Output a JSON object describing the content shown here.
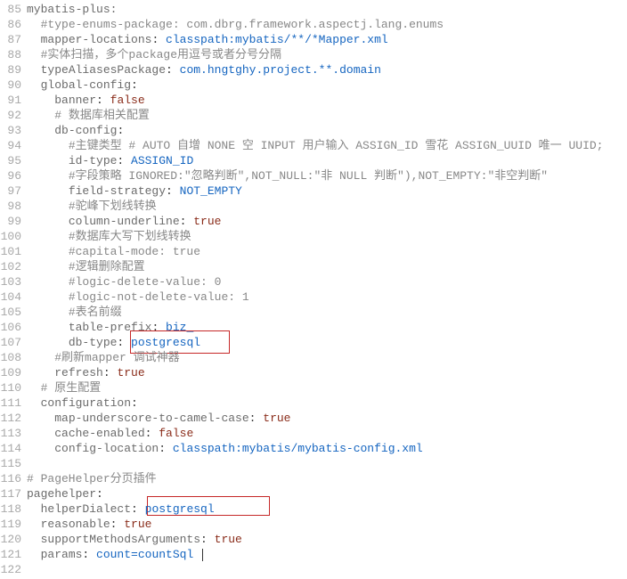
{
  "lines": [
    {
      "num": "85",
      "tokens": [
        {
          "t": "mybatis-plus",
          "c": "c-key"
        },
        {
          "t": ":",
          "c": "c-key"
        }
      ],
      "indent": 0
    },
    {
      "num": "86",
      "tokens": [
        {
          "t": "#type-enums-package: com.dbrg.framework.aspectj.lang.enums",
          "c": "c-comment"
        }
      ],
      "indent": 2
    },
    {
      "num": "87",
      "tokens": [
        {
          "t": "mapper-locations",
          "c": "c-key"
        },
        {
          "t": ": ",
          "c": ""
        },
        {
          "t": "classpath:mybatis/**/*Mapper.xml",
          "c": "c-str"
        }
      ],
      "indent": 2
    },
    {
      "num": "88",
      "tokens": [
        {
          "t": "#实体扫描，多个package用逗号或者分号分隔",
          "c": "c-comment"
        }
      ],
      "indent": 2
    },
    {
      "num": "89",
      "tokens": [
        {
          "t": "typeAliasesPackage",
          "c": "c-key"
        },
        {
          "t": ": ",
          "c": ""
        },
        {
          "t": "com.hngtghy.project.**.domain",
          "c": "c-str"
        }
      ],
      "indent": 2
    },
    {
      "num": "90",
      "tokens": [
        {
          "t": "global-config",
          "c": "c-key"
        },
        {
          "t": ":",
          "c": ""
        }
      ],
      "indent": 2
    },
    {
      "num": "91",
      "tokens": [
        {
          "t": "banner",
          "c": "c-key"
        },
        {
          "t": ": ",
          "c": ""
        },
        {
          "t": "false",
          "c": "c-kw"
        }
      ],
      "indent": 4
    },
    {
      "num": "92",
      "tokens": [
        {
          "t": "# 数据库相关配置",
          "c": "c-comment"
        }
      ],
      "indent": 4
    },
    {
      "num": "93",
      "tokens": [
        {
          "t": "db-config",
          "c": "c-key"
        },
        {
          "t": ":",
          "c": ""
        }
      ],
      "indent": 4
    },
    {
      "num": "94",
      "tokens": [
        {
          "t": "#主键类型 # AUTO 自增 NONE 空 INPUT 用户输入 ASSIGN_ID 雪花 ASSIGN_UUID 唯一 UUID;",
          "c": "c-comment"
        }
      ],
      "indent": 6
    },
    {
      "num": "95",
      "tokens": [
        {
          "t": "id-type",
          "c": "c-key"
        },
        {
          "t": ": ",
          "c": ""
        },
        {
          "t": "ASSIGN_ID",
          "c": "c-str"
        }
      ],
      "indent": 6
    },
    {
      "num": "96",
      "tokens": [
        {
          "t": "#字段策略 IGNORED:\"忽略判断\",NOT_NULL:\"非 NULL 判断\"),NOT_EMPTY:\"非空判断\"",
          "c": "c-comment"
        }
      ],
      "indent": 6
    },
    {
      "num": "97",
      "tokens": [
        {
          "t": "field-strategy",
          "c": "c-key"
        },
        {
          "t": ": ",
          "c": ""
        },
        {
          "t": "NOT_EMPTY",
          "c": "c-str"
        }
      ],
      "indent": 6
    },
    {
      "num": "98",
      "tokens": [
        {
          "t": "#驼峰下划线转换",
          "c": "c-comment"
        }
      ],
      "indent": 6
    },
    {
      "num": "99",
      "tokens": [
        {
          "t": "column-underline",
          "c": "c-key"
        },
        {
          "t": ": ",
          "c": ""
        },
        {
          "t": "true",
          "c": "c-kw"
        }
      ],
      "indent": 6
    },
    {
      "num": "100",
      "tokens": [
        {
          "t": "#数据库大写下划线转换",
          "c": "c-comment"
        }
      ],
      "indent": 6
    },
    {
      "num": "101",
      "tokens": [
        {
          "t": "#capital-mode: true",
          "c": "c-comment"
        }
      ],
      "indent": 6
    },
    {
      "num": "102",
      "tokens": [
        {
          "t": "#逻辑删除配置",
          "c": "c-comment"
        }
      ],
      "indent": 6
    },
    {
      "num": "103",
      "tokens": [
        {
          "t": "#logic-delete-value: 0",
          "c": "c-comment"
        }
      ],
      "indent": 6
    },
    {
      "num": "104",
      "tokens": [
        {
          "t": "#logic-not-delete-value: 1",
          "c": "c-comment"
        }
      ],
      "indent": 6
    },
    {
      "num": "105",
      "tokens": [
        {
          "t": "#表名前缀",
          "c": "c-comment"
        }
      ],
      "indent": 6
    },
    {
      "num": "106",
      "tokens": [
        {
          "t": "table-prefix",
          "c": "c-key"
        },
        {
          "t": ": ",
          "c": ""
        },
        {
          "t": "biz_",
          "c": "c-str"
        }
      ],
      "indent": 6
    },
    {
      "num": "107",
      "tokens": [
        {
          "t": "db-type",
          "c": "c-key"
        },
        {
          "t": ": ",
          "c": ""
        },
        {
          "t": "postgresql",
          "c": "c-str"
        }
      ],
      "indent": 6
    },
    {
      "num": "108",
      "tokens": [
        {
          "t": "#刷新mapper 调试神器",
          "c": "c-comment"
        }
      ],
      "indent": 4
    },
    {
      "num": "109",
      "tokens": [
        {
          "t": "refresh",
          "c": "c-key"
        },
        {
          "t": ": ",
          "c": ""
        },
        {
          "t": "true",
          "c": "c-kw"
        }
      ],
      "indent": 4
    },
    {
      "num": "110",
      "tokens": [
        {
          "t": "# 原生配置",
          "c": "c-comment"
        }
      ],
      "indent": 2
    },
    {
      "num": "111",
      "tokens": [
        {
          "t": "configuration",
          "c": "c-key"
        },
        {
          "t": ":",
          "c": ""
        }
      ],
      "indent": 2
    },
    {
      "num": "112",
      "tokens": [
        {
          "t": "map-underscore-to-camel-case",
          "c": "c-key"
        },
        {
          "t": ": ",
          "c": ""
        },
        {
          "t": "true",
          "c": "c-kw"
        }
      ],
      "indent": 4
    },
    {
      "num": "113",
      "tokens": [
        {
          "t": "cache-enabled",
          "c": "c-key"
        },
        {
          "t": ": ",
          "c": ""
        },
        {
          "t": "false",
          "c": "c-kw"
        }
      ],
      "indent": 4
    },
    {
      "num": "114",
      "tokens": [
        {
          "t": "config-location",
          "c": "c-key"
        },
        {
          "t": ": ",
          "c": ""
        },
        {
          "t": "classpath:mybatis/mybatis-config.xml",
          "c": "c-str"
        }
      ],
      "indent": 4
    },
    {
      "num": "115",
      "tokens": [],
      "indent": 0
    },
    {
      "num": "116",
      "tokens": [
        {
          "t": "# PageHelper分页插件",
          "c": "c-comment"
        }
      ],
      "indent": 0
    },
    {
      "num": "117",
      "tokens": [
        {
          "t": "pagehelper",
          "c": "c-key"
        },
        {
          "t": ":",
          "c": ""
        }
      ],
      "indent": 0
    },
    {
      "num": "118",
      "tokens": [
        {
          "t": "helperDialect",
          "c": "c-key"
        },
        {
          "t": ": ",
          "c": ""
        },
        {
          "t": "postgresql",
          "c": "c-str"
        }
      ],
      "indent": 2
    },
    {
      "num": "119",
      "tokens": [
        {
          "t": "reasonable",
          "c": "c-key"
        },
        {
          "t": ": ",
          "c": ""
        },
        {
          "t": "true",
          "c": "c-kw"
        }
      ],
      "indent": 2
    },
    {
      "num": "120",
      "tokens": [
        {
          "t": "supportMethodsArguments",
          "c": "c-key"
        },
        {
          "t": ": ",
          "c": ""
        },
        {
          "t": "true",
          "c": "c-kw"
        }
      ],
      "indent": 2
    },
    {
      "num": "121",
      "tokens": [
        {
          "t": "params",
          "c": "c-key"
        },
        {
          "t": ": ",
          "c": ""
        },
        {
          "t": "count=countSql",
          "c": "c-str"
        },
        {
          "t": " ",
          "c": ""
        }
      ],
      "indent": 2,
      "cursor": true
    },
    {
      "num": "122",
      "tokens": [],
      "indent": 0
    }
  ]
}
